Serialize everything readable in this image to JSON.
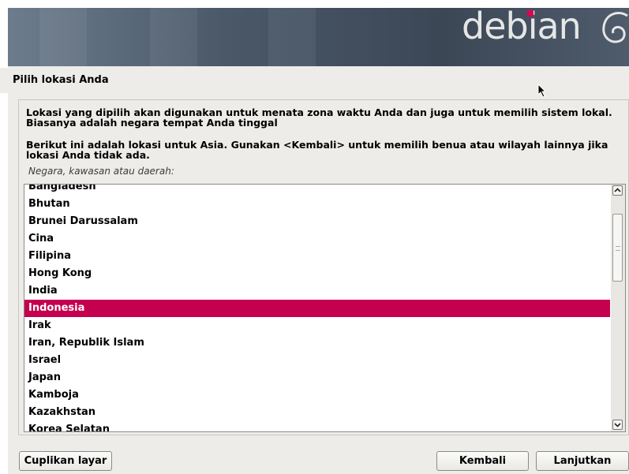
{
  "header": {
    "logo_text": "debian",
    "accent": "#d70751"
  },
  "page": {
    "title": "Pilih lokasi Anda"
  },
  "description": {
    "line1": "Lokasi yang dipilih akan digunakan untuk menata zona waktu Anda dan juga untuk memilih sistem lokal. Biasanya adalah negara tempat Anda tinggal",
    "line2": "Berikut ini adalah lokasi untuk Asia. Gunakan <Kembali> untuk memilih benua atau wilayah lainnya jika lokasi Anda tidak ada.",
    "field_label": "Negara, kawasan atau daerah:"
  },
  "list": {
    "items": [
      "Bangladesh",
      "Bhutan",
      "Brunei Darussalam",
      "Cina",
      "Filipina",
      "Hong Kong",
      "India",
      "Indonesia",
      "Irak",
      "Iran, Republik Islam",
      "Israel",
      "Japan",
      "Kamboja",
      "Kazakhstan",
      "Korea Selatan"
    ],
    "selected": "Indonesia",
    "selected_color": "#c4004f"
  },
  "buttons": {
    "screenshot": "Cuplikan layar",
    "back": "Kembali",
    "continue": "Lanjutkan"
  }
}
